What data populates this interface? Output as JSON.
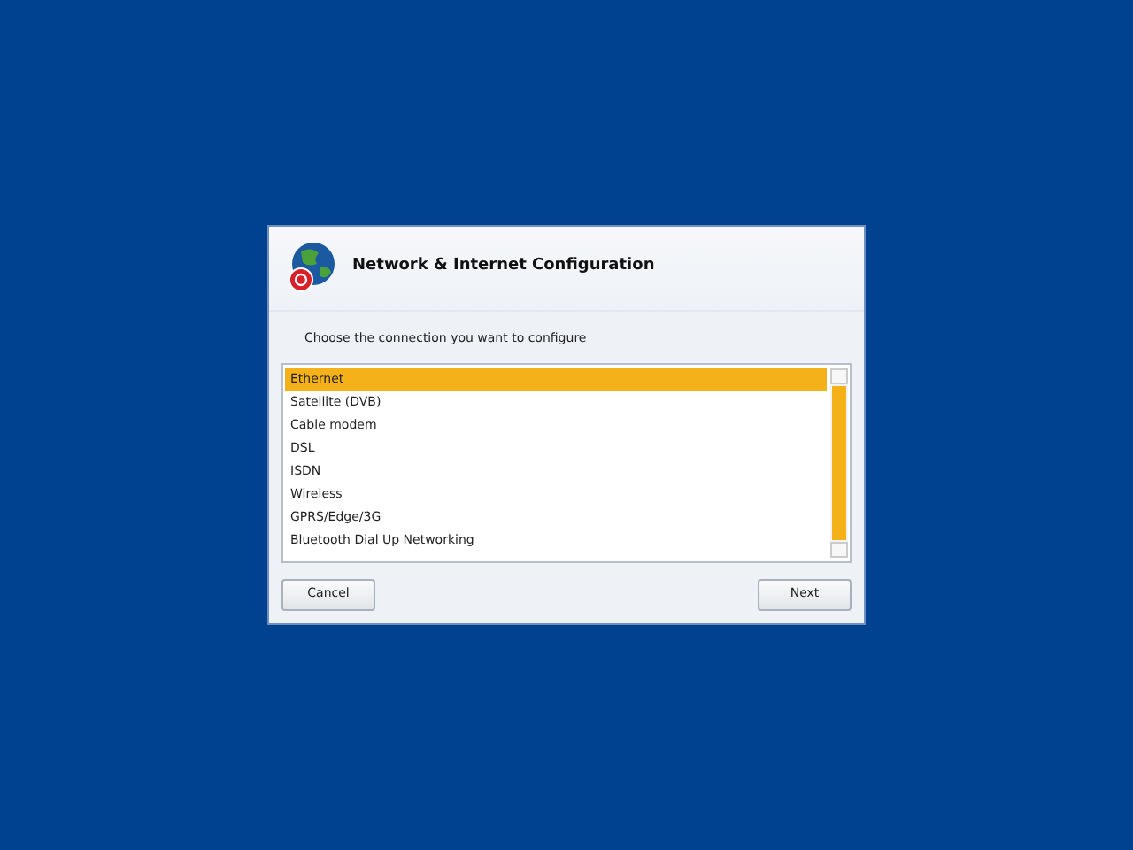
{
  "dialog": {
    "title": "Network & Internet Configuration",
    "prompt": "Choose the connection you want to configure"
  },
  "connections": [
    {
      "label": "Ethernet",
      "selected": true
    },
    {
      "label": "Satellite (DVB)",
      "selected": false
    },
    {
      "label": "Cable modem",
      "selected": false
    },
    {
      "label": "DSL",
      "selected": false
    },
    {
      "label": "ISDN",
      "selected": false
    },
    {
      "label": "Wireless",
      "selected": false
    },
    {
      "label": "GPRS/Edge/3G",
      "selected": false
    },
    {
      "label": "Bluetooth Dial Up Networking",
      "selected": false
    }
  ],
  "buttons": {
    "cancel": "Cancel",
    "next": "Next"
  }
}
